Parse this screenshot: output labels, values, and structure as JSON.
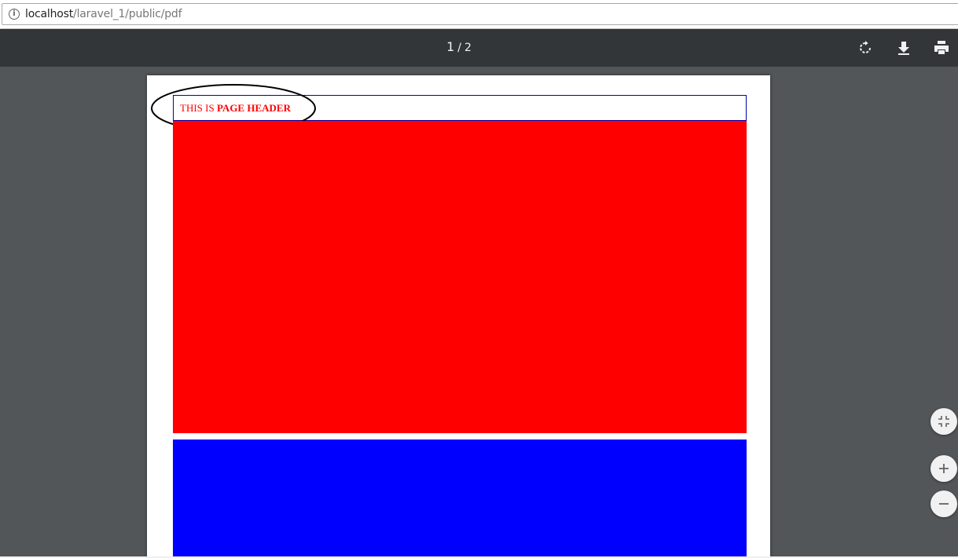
{
  "browser": {
    "url_host": "localhost",
    "url_path": "/laravel_1/public/pdf",
    "info_icon": "info-icon"
  },
  "toolbar": {
    "current_page": "1",
    "separator": "/",
    "total_pages": "2",
    "buttons": {
      "rotate": "rotate-icon",
      "download": "download-icon",
      "print": "print-icon"
    },
    "bg_color": "#323639"
  },
  "document": {
    "header_prefix": "THIS IS ",
    "header_bold": "PAGE HEADER",
    "header_color": "#ff0000",
    "block_colors": [
      "#ff0000",
      "#0000ff"
    ]
  },
  "zoom_controls": {
    "fit": "fit-to-page-icon",
    "zoom_in": "zoom-in-icon",
    "zoom_out": "zoom-out-icon"
  }
}
